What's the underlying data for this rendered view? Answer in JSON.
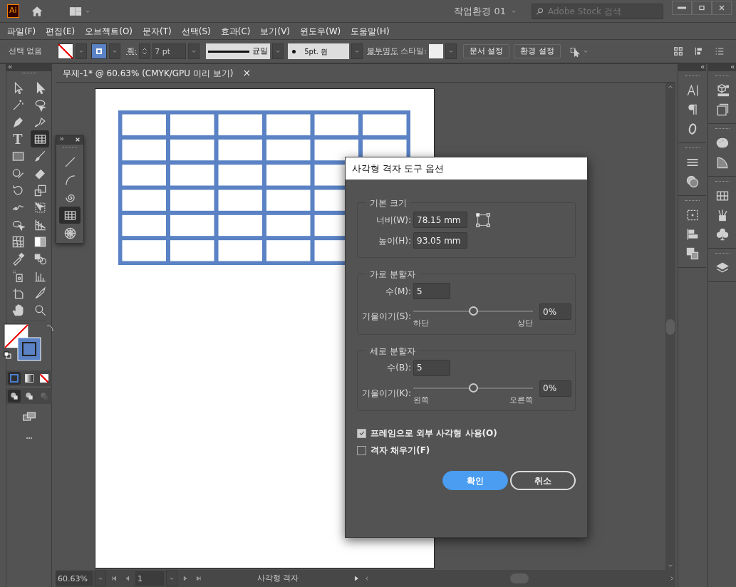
{
  "app_bar": {
    "logo": "Ai",
    "workspace": "작업환경 01",
    "search": {
      "placeholder": "Adobe Stock 검색"
    }
  },
  "menu": [
    "파일(F)",
    "편집(E)",
    "오브젝트(O)",
    "문자(T)",
    "선택(S)",
    "효과(C)",
    "보기(V)",
    "윈도우(W)",
    "도움말(H)"
  ],
  "control_bar": {
    "selection": "선택 없음",
    "stroke_label": "획:",
    "stroke_weight": "7 pt",
    "stroke_profile": "균일",
    "brush": "5pt. 원",
    "opacity_label": "불투명도",
    "style_label": "스타일:",
    "buttons": [
      "문서 설정",
      "환경 설정"
    ]
  },
  "tools": [
    {
      "kind": "select",
      "selected": false
    },
    {
      "kind": "direct",
      "selected": false
    },
    {
      "kind": "wand",
      "selected": false
    },
    {
      "kind": "lasso",
      "selected": false
    },
    {
      "kind": "pen",
      "selected": false
    },
    {
      "kind": "curvature",
      "selected": false
    },
    {
      "kind": "type",
      "label": "T",
      "selected": false
    },
    {
      "kind": "grid",
      "selected": true
    },
    {
      "kind": "rect",
      "selected": false
    },
    {
      "kind": "brush",
      "selected": false
    },
    {
      "kind": "shaper",
      "selected": false
    },
    {
      "kind": "eraser",
      "selected": false
    },
    {
      "kind": "rotate",
      "selected": false
    },
    {
      "kind": "scale",
      "selected": false
    },
    {
      "kind": "warp",
      "selected": false
    },
    {
      "kind": "transform",
      "selected": false
    },
    {
      "kind": "builder",
      "selected": false
    },
    {
      "kind": "perspective",
      "selected": false
    },
    {
      "kind": "mesh",
      "selected": false
    },
    {
      "kind": "gradient",
      "selected": false
    },
    {
      "kind": "eyedropper",
      "selected": false
    },
    {
      "kind": "blend",
      "selected": false
    },
    {
      "kind": "sprayer",
      "selected": false
    },
    {
      "kind": "graph",
      "selected": false
    },
    {
      "kind": "artboard",
      "selected": false
    },
    {
      "kind": "slice",
      "selected": false
    },
    {
      "kind": "hand",
      "selected": false
    },
    {
      "kind": "zoom",
      "selected": false
    }
  ],
  "flyout_tools": [
    {
      "kind": "line",
      "selected": false
    },
    {
      "kind": "arc",
      "selected": false
    },
    {
      "kind": "spiral",
      "selected": false
    },
    {
      "kind": "grid",
      "selected": true
    },
    {
      "kind": "polar",
      "selected": false
    }
  ],
  "document_tab": {
    "title": "무제-1* @ 60.63% (CMYK/GPU 미리 보기)",
    "close": "×"
  },
  "dialog": {
    "title": "사각형 격자 도구 옵션",
    "size": {
      "title": "기본 크기",
      "width": {
        "label": "너비(W):",
        "value": "78.15 mm"
      },
      "height": {
        "label": "높이(H):",
        "value": "93.05 mm"
      }
    },
    "dividers": [
      {
        "title": "가로 분할자",
        "count_label": "수(M):",
        "count": "5",
        "skew_label": "기울이기(S):",
        "level": 0.5,
        "skew": "0%",
        "min_label": "하단",
        "max_label": "상단"
      },
      {
        "title": "세로 분할자",
        "count_label": "수(B):",
        "count": "5",
        "skew_label": "기울이기(K):",
        "level": 0.5,
        "skew": "0%",
        "min_label": "왼쪽",
        "max_label": "오른쪽"
      }
    ],
    "options": [
      {
        "label": "프레임으로 외부 사각형 사용(O)",
        "checked": true
      },
      {
        "label": "격자 채우기(F)",
        "checked": false
      }
    ],
    "buttons": [
      {
        "label": "확인",
        "kind": "primary"
      },
      {
        "label": "취소",
        "kind": "secondary"
      }
    ]
  },
  "status_bar": {
    "zoom": "60.63%",
    "page": "1",
    "tool": "사각형 격자"
  }
}
